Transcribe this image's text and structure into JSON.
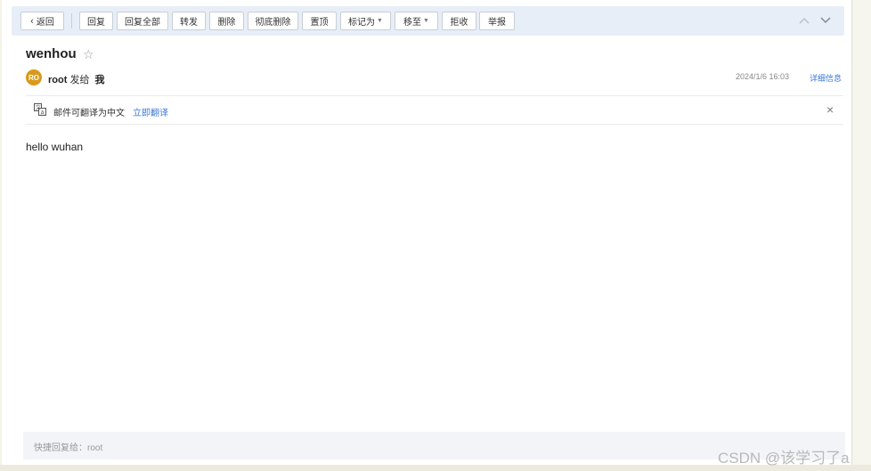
{
  "toolbar": {
    "back": "返回",
    "reply": "回复",
    "reply_all": "回复全部",
    "forward": "转发",
    "delete": "删除",
    "delete_permanently": "彻底删除",
    "pin": "置顶",
    "mark_as": "标记为",
    "move_to": "移至",
    "reject": "拒收",
    "report": "举报"
  },
  "email": {
    "subject": "wenhou",
    "avatar_initials": "RO",
    "avatar_color": "#d99a1b",
    "sender": "root",
    "sent_to_label": "发给",
    "recipient": "我",
    "date": "2024/1/6 16:03",
    "details_link": "详细信息",
    "body": "hello wuhan"
  },
  "translate": {
    "message": "邮件可翻译为中文",
    "action": "立即翻译",
    "close": "×"
  },
  "quick_reply": {
    "placeholder": "快捷回复给：root"
  },
  "watermark": "CSDN @该学习了a",
  "colors": {
    "link": "#3b78d8",
    "toolbar_bg": "#e8eef8"
  },
  "icons": {
    "star": "star-icon",
    "prev": "chevron-up-icon",
    "next": "chevron-down-icon",
    "translate": "translate-icon",
    "close": "close-icon"
  }
}
